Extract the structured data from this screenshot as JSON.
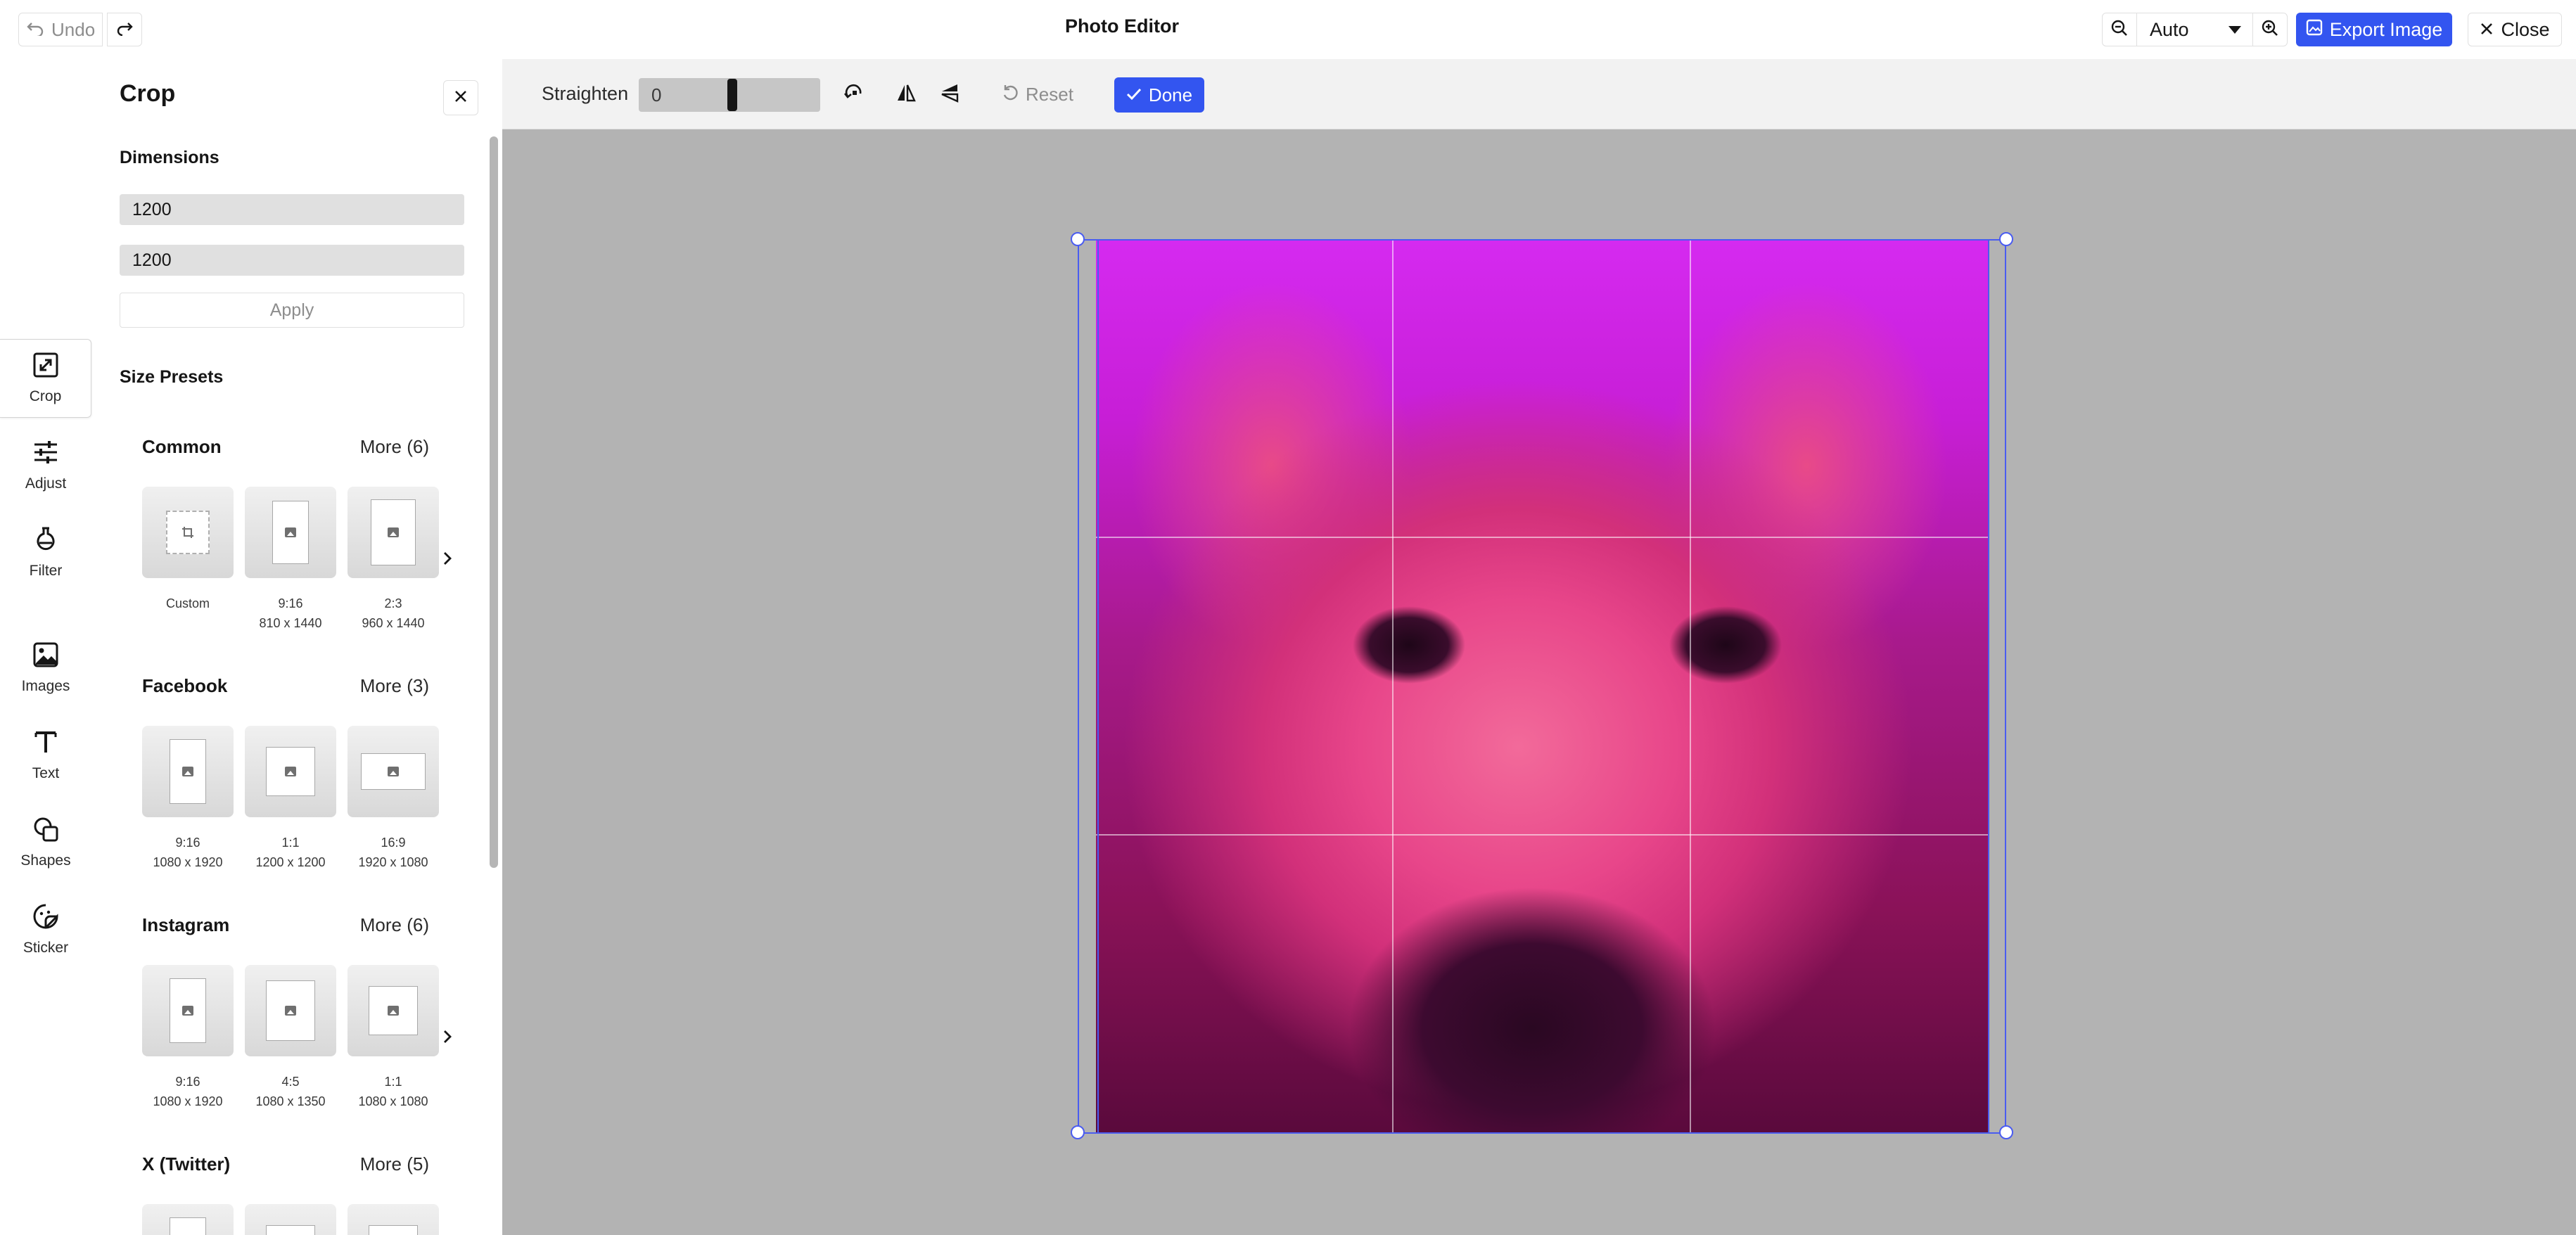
{
  "app": {
    "title": "Photo Editor"
  },
  "header": {
    "undo_label": "Undo",
    "zoom_value": "Auto",
    "export_label": "Export Image",
    "close_label": "Close"
  },
  "nav": {
    "items": [
      {
        "label": "Crop",
        "icon": "crop-icon"
      },
      {
        "label": "Adjust",
        "icon": "sliders-icon"
      },
      {
        "label": "Filter",
        "icon": "flask-icon"
      },
      {
        "label": "Images",
        "icon": "image-icon"
      },
      {
        "label": "Text",
        "icon": "text-icon"
      },
      {
        "label": "Shapes",
        "icon": "shapes-icon"
      },
      {
        "label": "Sticker",
        "icon": "sticker-icon"
      }
    ]
  },
  "panel": {
    "title": "Crop",
    "dimensions_label": "Dimensions",
    "width_value": "1200",
    "height_value": "1200",
    "apply_label": "Apply",
    "size_presets_label": "Size Presets",
    "groups": [
      {
        "title": "Common",
        "more": "More (6)",
        "presets": [
          {
            "ratio": "Custom",
            "size": ""
          },
          {
            "ratio": "9:16",
            "size": "810 x 1440"
          },
          {
            "ratio": "2:3",
            "size": "960 x 1440"
          }
        ]
      },
      {
        "title": "Facebook",
        "more": "More (3)",
        "presets": [
          {
            "ratio": "9:16",
            "size": "1080 x 1920"
          },
          {
            "ratio": "1:1",
            "size": "1200 x 1200"
          },
          {
            "ratio": "16:9",
            "size": "1920 x 1080"
          }
        ]
      },
      {
        "title": "Instagram",
        "more": "More (6)",
        "presets": [
          {
            "ratio": "9:16",
            "size": "1080 x 1920"
          },
          {
            "ratio": "4:5",
            "size": "1080 x 1350"
          },
          {
            "ratio": "1:1",
            "size": "1080 x 1080"
          }
        ]
      },
      {
        "title": "X (Twitter)",
        "more": "More (5)",
        "presets": []
      }
    ]
  },
  "toolbar": {
    "straighten_label": "Straighten",
    "straighten_value": "0",
    "reset_label": "Reset",
    "done_label": "Done"
  },
  "colors": {
    "accent": "#3355f0",
    "crop_frame": "#4a5cf0",
    "canvas_bg": "#b3b3b3"
  }
}
